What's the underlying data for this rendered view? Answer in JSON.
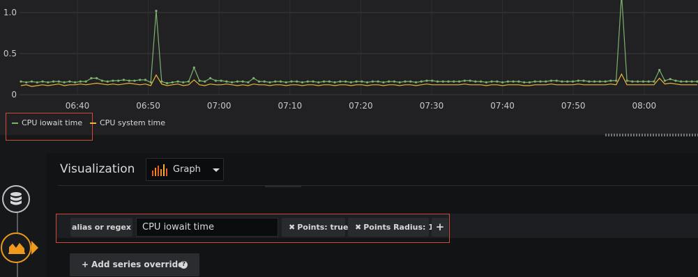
{
  "chart_data": {
    "type": "line",
    "x_tick_labels": [
      "06:40",
      "06:50",
      "07:00",
      "07:10",
      "07:20",
      "07:30",
      "07:40",
      "07:50",
      "08:00"
    ],
    "y_tick_labels": [
      "0",
      "0.5",
      "1.0"
    ],
    "ylim": [
      0,
      1.15
    ],
    "grid": true,
    "legend_position": "bottom-left",
    "series": [
      {
        "name": "CPU iowait time",
        "color": "#7eb26d",
        "points": true,
        "values": [
          0.16,
          0.15,
          0.16,
          0.15,
          0.16,
          0.15,
          0.16,
          0.16,
          0.15,
          0.16,
          0.15,
          0.16,
          0.16,
          0.2,
          0.2,
          0.17,
          0.16,
          0.17,
          0.17,
          0.18,
          0.17,
          0.17,
          0.18,
          0.18,
          0.15,
          1.02,
          0.16,
          0.14,
          0.15,
          0.16,
          0.15,
          0.16,
          0.33,
          0.17,
          0.16,
          0.2,
          0.17,
          0.17,
          0.16,
          0.15,
          0.16,
          0.16,
          0.15,
          0.2,
          0.16,
          0.16,
          0.15,
          0.16,
          0.16,
          0.15,
          0.16,
          0.16,
          0.15,
          0.16,
          0.16,
          0.15,
          0.16,
          0.16,
          0.15,
          0.16,
          0.16,
          0.15,
          0.16,
          0.16,
          0.15,
          0.16,
          0.16,
          0.15,
          0.16,
          0.16,
          0.15,
          0.16,
          0.16,
          0.15,
          0.16,
          0.17,
          0.17,
          0.16,
          0.16,
          0.16,
          0.16,
          0.16,
          0.17,
          0.17,
          0.16,
          0.16,
          0.15,
          0.16,
          0.16,
          0.15,
          0.16,
          0.16,
          0.16,
          0.15,
          0.15,
          0.16,
          0.16,
          0.16,
          0.17,
          0.17,
          0.16,
          0.16,
          0.16,
          0.17,
          0.17,
          0.16,
          0.16,
          0.16,
          0.16,
          0.17,
          0.17,
          1.22,
          0.17,
          0.16,
          0.16,
          0.16,
          0.16,
          0.16,
          0.3,
          0.17,
          0.19,
          0.17,
          0.16,
          0.16,
          0.16,
          0.16
        ]
      },
      {
        "name": "CPU system time",
        "color": "#eab839",
        "points": false,
        "values": [
          0.11,
          0.12,
          0.1,
          0.11,
          0.12,
          0.11,
          0.12,
          0.13,
          0.11,
          0.12,
          0.12,
          0.13,
          0.12,
          0.13,
          0.14,
          0.13,
          0.12,
          0.13,
          0.12,
          0.13,
          0.14,
          0.13,
          0.12,
          0.13,
          0.11,
          0.24,
          0.13,
          0.11,
          0.12,
          0.13,
          0.11,
          0.12,
          0.18,
          0.12,
          0.11,
          0.13,
          0.12,
          0.12,
          0.13,
          0.12,
          0.11,
          0.12,
          0.11,
          0.13,
          0.12,
          0.12,
          0.11,
          0.12,
          0.12,
          0.11,
          0.12,
          0.12,
          0.11,
          0.12,
          0.12,
          0.11,
          0.12,
          0.12,
          0.11,
          0.12,
          0.12,
          0.11,
          0.12,
          0.12,
          0.11,
          0.12,
          0.12,
          0.11,
          0.12,
          0.12,
          0.11,
          0.12,
          0.12,
          0.11,
          0.12,
          0.13,
          0.12,
          0.12,
          0.12,
          0.12,
          0.12,
          0.12,
          0.13,
          0.12,
          0.12,
          0.12,
          0.11,
          0.12,
          0.12,
          0.11,
          0.12,
          0.12,
          0.12,
          0.11,
          0.11,
          0.12,
          0.12,
          0.12,
          0.13,
          0.12,
          0.12,
          0.12,
          0.12,
          0.13,
          0.12,
          0.12,
          0.12,
          0.12,
          0.12,
          0.13,
          0.12,
          0.25,
          0.12,
          0.12,
          0.12,
          0.12,
          0.12,
          0.12,
          0.2,
          0.13,
          0.14,
          0.13,
          0.12,
          0.12,
          0.12,
          0.12
        ]
      }
    ]
  },
  "legend": {
    "items": [
      {
        "label": "CPU iowait time",
        "color": "#7eb26d"
      },
      {
        "label": "CPU system time",
        "color": "#eab839"
      }
    ]
  },
  "editor": {
    "title": "Visualization",
    "viz_picker_label": "Graph",
    "override": {
      "alias_label": "alias or regex",
      "alias_value": "CPU iowait time",
      "tags": [
        "Points: true",
        "Points Radius: 1"
      ],
      "add_label": "+"
    },
    "add_series_label": "Add series override",
    "help_glyph": "?"
  },
  "icons": [
    "database-icon",
    "graph-visualization-icon",
    "close-icon",
    "plus-icon",
    "help-icon",
    "chevron-down-icon"
  ],
  "colors": {
    "accent": "#f09a1b",
    "highlight_outline": "#d44a3a"
  }
}
